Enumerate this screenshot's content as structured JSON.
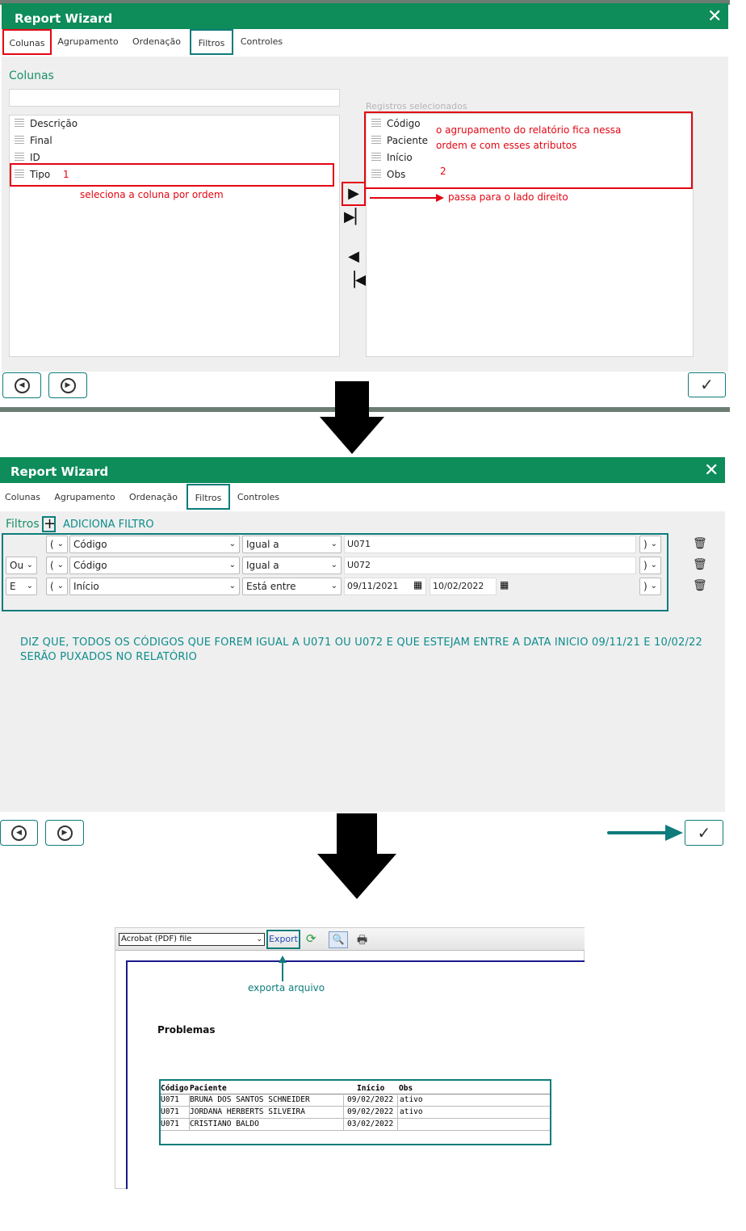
{
  "window": {
    "title": "Report Wizard",
    "close_glyph": "✕"
  },
  "tabs": [
    "Colunas",
    "Agrupamento",
    "Ordenação",
    "Filtros",
    "Controles"
  ],
  "panel1": {
    "section_label": "Colunas",
    "search_value": "",
    "left_items": [
      "Descrição",
      "Final",
      "ID",
      "Tipo"
    ],
    "right_label": "Registros selecionados",
    "right_items": [
      "Código",
      "Paciente",
      "Início",
      "Obs"
    ],
    "ann_1": "1",
    "ann_seleciona": "seleciona a coluna por ordem",
    "ann_agrup_1": "o agrupamento do relatório fica nessa",
    "ann_agrup_2": "ordem  e com esses atributos",
    "ann_2": "2",
    "ann_passa": "passa para o lado direito"
  },
  "panel2": {
    "filters_label": "Filtros",
    "add_filter": "ADICIONA FILTRO",
    "rows": [
      {
        "logic": "",
        "open": "(",
        "field": "Código",
        "op": "Igual a",
        "value": "U071",
        "value2": "",
        "close": ")"
      },
      {
        "logic": "Ou",
        "open": "(",
        "field": "Código",
        "op": "Igual a",
        "value": "U072",
        "value2": "",
        "close": ")"
      },
      {
        "logic": "E",
        "open": "(",
        "field": "Início",
        "op": "Está entre",
        "value": "09/11/2021",
        "value2": "10/02/2022",
        "close": ")"
      }
    ],
    "explain_1": "DIZ QUE, TODOS OS CÓDIGOS QUE FOREM IGUAL A U071 OU U072 E QUE ESTEJAM ENTRE A DATA INICIO 09/11/21 E 10/02/22",
    "explain_2": "SERÃO PUXADOS NO RELATÓRIO"
  },
  "panel3": {
    "format_select": "Acrobat (PDF) file",
    "export_label": "Export",
    "ann_export": "exporta arquivo",
    "report_title": "Problemas",
    "columns": [
      "Código",
      "Paciente",
      "Início",
      "Obs"
    ],
    "rows": [
      [
        "U071",
        "BRUNA DOS SANTOS SCHNEIDER",
        "09/02/2022",
        "ativo"
      ],
      [
        "U071",
        "JORDANA HERBERTS SILVEIRA",
        "09/02/2022",
        "ativo"
      ],
      [
        "U071",
        "CRISTIANO BALDO",
        "03/02/2022",
        ""
      ]
    ]
  },
  "colors": {
    "green": "#0e8c5a",
    "teal": "#0e7c7b",
    "red": "#e30613"
  }
}
